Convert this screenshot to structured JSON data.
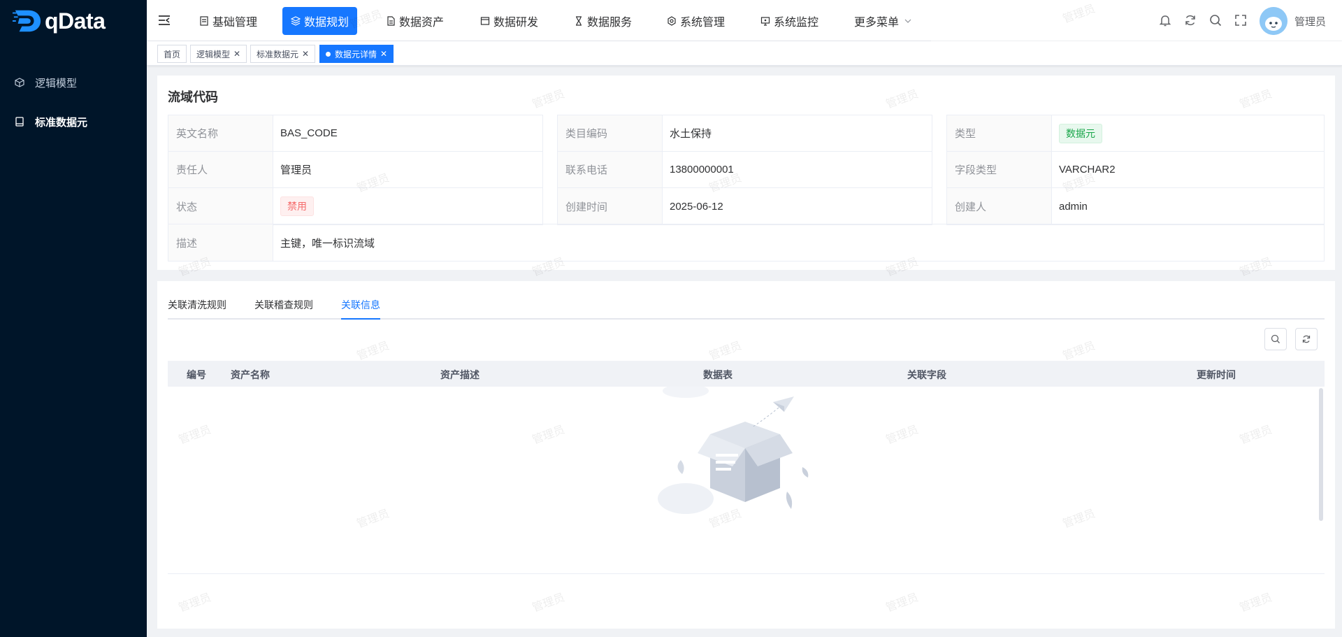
{
  "app": {
    "logo_text": "qData",
    "user_name": "管理员",
    "watermark": "管理员"
  },
  "sidebar": {
    "items": [
      {
        "label": "逻辑模型",
        "icon": "cube-icon"
      },
      {
        "label": "标准数据元",
        "icon": "book-icon"
      }
    ]
  },
  "nav": {
    "items": [
      {
        "label": "基础管理",
        "icon": "grid-icon"
      },
      {
        "label": "数据规划",
        "icon": "layers-icon"
      },
      {
        "label": "数据资产",
        "icon": "document-icon"
      },
      {
        "label": "数据研发",
        "icon": "window-icon"
      },
      {
        "label": "数据服务",
        "icon": "hourglass-icon"
      },
      {
        "label": "系统管理",
        "icon": "settings-icon"
      },
      {
        "label": "系统监控",
        "icon": "monitor-icon"
      },
      {
        "label": "更多菜单",
        "icon": "chevron-down-icon"
      }
    ],
    "active_index": 1
  },
  "tags": [
    {
      "label": "首页"
    },
    {
      "label": "逻辑模型"
    },
    {
      "label": "标准数据元"
    },
    {
      "label": "数据元详情"
    }
  ],
  "detail": {
    "title": "流域代码",
    "col1": [
      {
        "label": "英文名称",
        "value": "BAS_CODE"
      },
      {
        "label": "责任人",
        "value": "管理员"
      },
      {
        "label": "状态",
        "value": "禁用"
      }
    ],
    "col2": [
      {
        "label": "类目编码",
        "value": "水土保持"
      },
      {
        "label": "联系电话",
        "value": "13800000001"
      },
      {
        "label": "创建时间",
        "value": "2025-06-12"
      }
    ],
    "col3": [
      {
        "label": "类型",
        "value": "数据元"
      },
      {
        "label": "字段类型",
        "value": "VARCHAR2"
      },
      {
        "label": "创建人",
        "value": "admin"
      }
    ],
    "description": {
      "label": "描述",
      "value": "主键，唯一标识流域"
    },
    "status_color": "#f56c6c",
    "type_color": "#19a64a"
  },
  "tabs": [
    {
      "label": "关联清洗规则"
    },
    {
      "label": "关联稽查规则"
    },
    {
      "label": "关联信息"
    }
  ],
  "active_tab": 2,
  "table": {
    "columns": [
      "编号",
      "资产名称",
      "资产描述",
      "数据表",
      "关联字段",
      "更新时间"
    ],
    "rows": []
  },
  "accent": "#1677ff"
}
